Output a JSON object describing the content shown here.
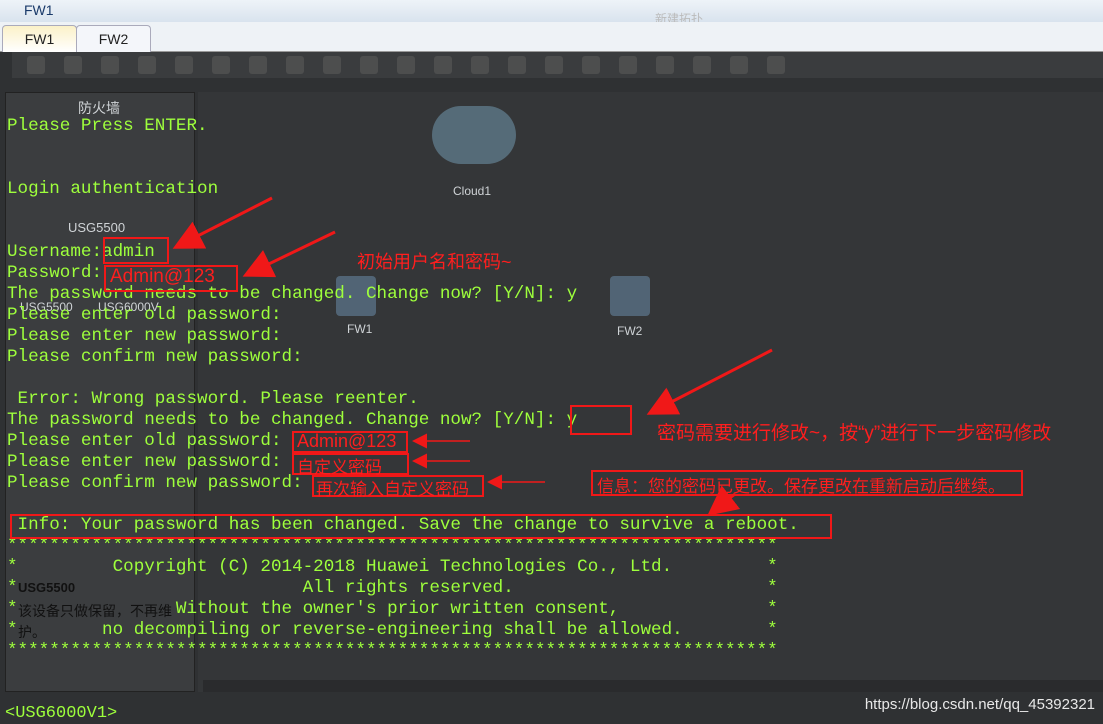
{
  "window": {
    "title": "FW1",
    "topology_title": "新建拓扑"
  },
  "tabs": [
    {
      "label": "FW1",
      "active": true
    },
    {
      "label": "FW2",
      "active": false
    }
  ],
  "sidebar": {
    "category": "防火墙",
    "group": "USG5500",
    "device_name": "USG5500",
    "description": "该设备只做保留，不再维护。",
    "devices": [
      "USG5500",
      "USG6000V"
    ]
  },
  "canvas": {
    "nodes": [
      "Cloud1",
      "FW1",
      "FW2"
    ]
  },
  "terminal": {
    "lines": [
      "Please Press ENTER.",
      "",
      "",
      "Login authentication",
      "",
      "",
      "Username:admin",
      "Password:",
      "The password needs to be changed. Change now? [Y/N]: y",
      "Please enter old password:",
      "Please enter new password:",
      "Please confirm new password:",
      "",
      " Error: Wrong password. Please reenter.",
      "The password needs to be changed. Change now? [Y/N]: y",
      "Please enter old password:",
      "Please enter new password:",
      "Please confirm new password:",
      "",
      " Info: Your password has been changed. Save the change to survive a reboot.",
      "*************************************************************************",
      "*         Copyright (C) 2014-2018 Huawei Technologies Co., Ltd.         *",
      "*                           All rights reserved.                        *",
      "*               Without the owner's prior written consent,              *",
      "*        no decompiling or reverse-engineering shall be allowed.        *",
      "*************************************************************************"
    ],
    "prompt": "<USG6000V1>"
  },
  "annotations": {
    "initial_password": "Admin@123",
    "initial_note": "初始用户名和密码~",
    "change_note": "密码需要进行修改~，按“y”进行下一步密码修改",
    "old_password": "Admin@123",
    "new_password": "自定义密码",
    "confirm_password": "再次输入自定义密码",
    "info_translation": "信息：您的密码已更改。保存更改在重新启动后继续。"
  },
  "watermark": "https://blog.csdn.net/qq_45392321",
  "colors": {
    "terminal_text": "#9eff3c",
    "annotation": "#f01818"
  }
}
